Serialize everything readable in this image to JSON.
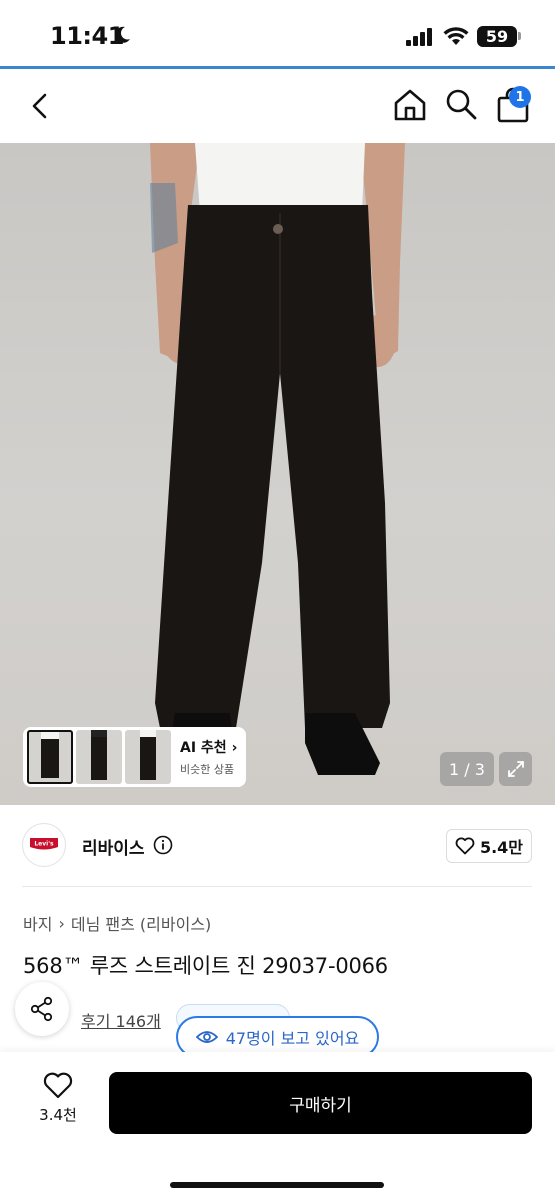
{
  "status": {
    "time": "11:41",
    "battery": "59"
  },
  "nav": {
    "cart_count": "1"
  },
  "gallery": {
    "counter": "1 / 3",
    "ai_recommend_title": "AI 추천",
    "ai_recommend_sub": "비슷한 상품"
  },
  "brand": {
    "name": "리바이스",
    "logo_text": "Levi's",
    "likes": "5.4만"
  },
  "breadcrumb": {
    "category": "바지",
    "subcategory": "데님 팬츠 (리바이스)"
  },
  "product": {
    "title": "568™ 루즈 스트레이트 진 29037-0066"
  },
  "reviews": {
    "label": "후기 146개"
  },
  "viewers": {
    "label": "47명이 보고 있어요"
  },
  "bottom": {
    "favorites": "3.4천",
    "buy_label": "구매하기"
  },
  "colors": {
    "accent": "#3b86d1",
    "badge": "#1f74e8",
    "viewer_border": "#2c7be5"
  }
}
